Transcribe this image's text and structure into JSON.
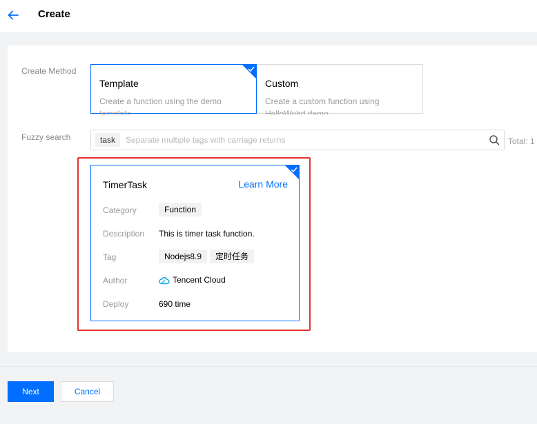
{
  "header": {
    "title": "Create"
  },
  "form": {
    "create_method_label": "Create Method",
    "fuzzy_search_label": "Fuzzy search",
    "methods": [
      {
        "title": "Template",
        "desc": "Create a function using the demo template",
        "selected": true
      },
      {
        "title": "Custom",
        "desc": "Create a custom function using HelloWolrd demo",
        "selected": false
      }
    ],
    "search": {
      "tag": "task",
      "placeholder": "Separate multiple tags with carriage returns",
      "total": "Total: 1"
    }
  },
  "template_card": {
    "title": "TimerTask",
    "learn_more": "Learn More",
    "labels": {
      "category": "Category",
      "description": "Description",
      "tag": "Tag",
      "author": "Author",
      "deploy": "Deploy"
    },
    "category": "Function",
    "description": "This is timer task function.",
    "tags": [
      "Nodejs8.9",
      "定时任务"
    ],
    "author": "Tencent Cloud",
    "deploy": "690 time"
  },
  "footer": {
    "next_label": "Next",
    "cancel_label": "Cancel"
  },
  "colors": {
    "accent": "#006eff",
    "highlight": "#e5312e"
  }
}
